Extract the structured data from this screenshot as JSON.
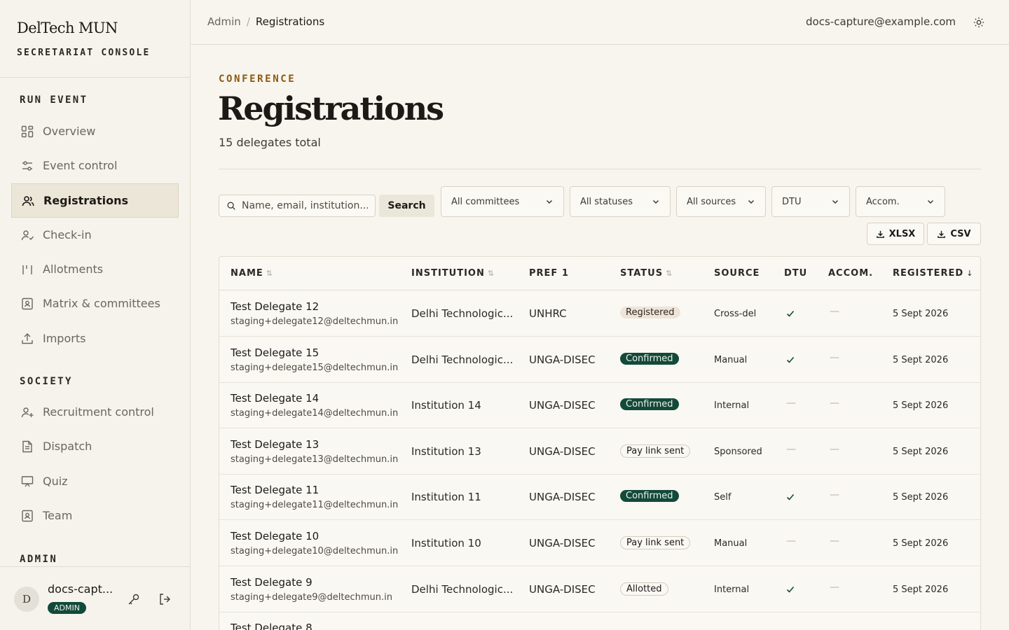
{
  "app": {
    "brand": "DelTech MUN",
    "subtitle": "SECRETARIAT CONSOLE"
  },
  "sidebar": {
    "sections": [
      {
        "label": "RUN EVENT"
      },
      {
        "label": "SOCIETY"
      },
      {
        "label": "ADMIN"
      }
    ],
    "items": [
      {
        "label": "Overview",
        "icon": "grid-icon"
      },
      {
        "label": "Event control",
        "icon": "sliders-icon"
      },
      {
        "label": "Registrations",
        "icon": "users-icon",
        "active": true
      },
      {
        "label": "Check-in",
        "icon": "user-check-icon"
      },
      {
        "label": "Allotments",
        "icon": "columns-icon"
      },
      {
        "label": "Matrix & committees",
        "icon": "id-card-icon"
      },
      {
        "label": "Imports",
        "icon": "upload-icon"
      },
      {
        "label": "Recruitment control",
        "icon": "user-plus-icon"
      },
      {
        "label": "Dispatch",
        "icon": "document-icon"
      },
      {
        "label": "Quiz",
        "icon": "presentation-icon"
      },
      {
        "label": "Team",
        "icon": "id-card-icon"
      }
    ],
    "user": {
      "initial": "D",
      "name": "docs-capt...",
      "role": "ADMIN"
    }
  },
  "header": {
    "breadcrumb": [
      "Admin",
      "Registrations"
    ],
    "email": "docs-capture@example.com"
  },
  "page": {
    "eyebrow": "CONFERENCE",
    "title": "Registrations",
    "subtitle": "15 delegates total"
  },
  "filters": {
    "search_placeholder": "Name, email, institution...",
    "search_button": "Search",
    "committee": "All committees",
    "status": "All statuses",
    "source": "All sources",
    "dtu": "DTU",
    "accom": "Accom.",
    "export_xlsx": "XLSX",
    "export_csv": "CSV"
  },
  "table": {
    "columns": [
      "NAME",
      "INSTITUTION",
      "PREF 1",
      "STATUS",
      "SOURCE",
      "DTU",
      "ACCOM.",
      "REGISTERED"
    ],
    "rows": [
      {
        "name": "Test Delegate 12",
        "email": "staging+delegate12@deltechmun.in",
        "institution": "Delhi Technologic...",
        "pref": "UNHRC",
        "status": "Registered",
        "status_kind": "registered",
        "source": "Cross-del",
        "dtu": true,
        "accom": false,
        "registered": "5 Sept 2026"
      },
      {
        "name": "Test Delegate 15",
        "email": "staging+delegate15@deltechmun.in",
        "institution": "Delhi Technologic...",
        "pref": "UNGA-DISEC",
        "status": "Confirmed",
        "status_kind": "confirmed",
        "source": "Manual",
        "dtu": true,
        "accom": false,
        "registered": "5 Sept 2026"
      },
      {
        "name": "Test Delegate 14",
        "email": "staging+delegate14@deltechmun.in",
        "institution": "Institution 14",
        "pref": "UNGA-DISEC",
        "status": "Confirmed",
        "status_kind": "confirmed",
        "source": "Internal",
        "dtu": false,
        "accom": false,
        "registered": "5 Sept 2026"
      },
      {
        "name": "Test Delegate 13",
        "email": "staging+delegate13@deltechmun.in",
        "institution": "Institution 13",
        "pref": "UNGA-DISEC",
        "status": "Pay link sent",
        "status_kind": "paylink",
        "source": "Sponsored",
        "dtu": false,
        "accom": false,
        "registered": "5 Sept 2026"
      },
      {
        "name": "Test Delegate 11",
        "email": "staging+delegate11@deltechmun.in",
        "institution": "Institution 11",
        "pref": "UNGA-DISEC",
        "status": "Confirmed",
        "status_kind": "confirmed",
        "source": "Self",
        "dtu": true,
        "accom": false,
        "registered": "5 Sept 2026"
      },
      {
        "name": "Test Delegate 10",
        "email": "staging+delegate10@deltechmun.in",
        "institution": "Institution 10",
        "pref": "UNGA-DISEC",
        "status": "Pay link sent",
        "status_kind": "paylink",
        "source": "Manual",
        "dtu": false,
        "accom": false,
        "registered": "5 Sept 2026"
      },
      {
        "name": "Test Delegate 9",
        "email": "staging+delegate9@deltechmun.in",
        "institution": "Delhi Technologic...",
        "pref": "UNGA-DISEC",
        "status": "Allotted",
        "status_kind": "allotted",
        "source": "Internal",
        "dtu": true,
        "accom": false,
        "registered": "5 Sept 2026"
      },
      {
        "name": "Test Delegate 8",
        "email": "",
        "institution": "",
        "pref": "",
        "status": "",
        "status_kind": "registered",
        "source": "",
        "dtu": false,
        "accom": false,
        "registered": ""
      }
    ]
  },
  "colors": {
    "accent": "#124a3a",
    "eyebrow": "#8a5a12",
    "background": "#f8f5ee"
  }
}
